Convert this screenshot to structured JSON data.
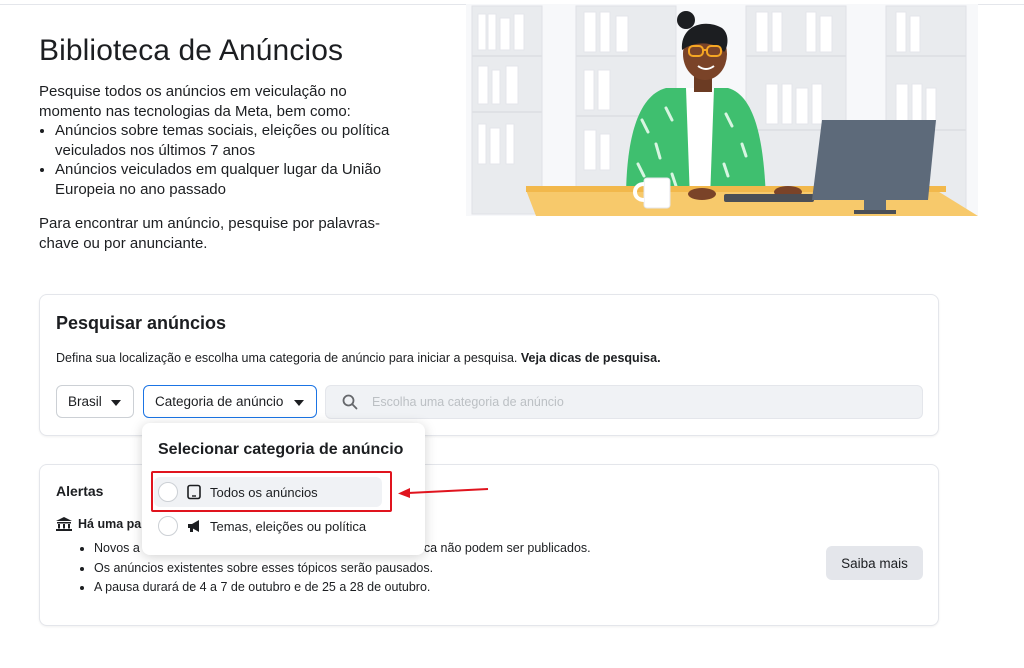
{
  "hero": {
    "title": "Biblioteca de Anúncios",
    "intro": "Pesquise todos os anúncios em veiculação no momento nas tecnologias da Meta, bem como:",
    "bullets": [
      "Anúncios sobre temas sociais, eleições ou política veiculados nos últimos 7 anos",
      "Anúncios veiculados em qualquer lugar da União Europeia no ano passado"
    ],
    "outro": "Para encontrar um anúncio, pesquise por palavras-chave ou por anunciante."
  },
  "search": {
    "title": "Pesquisar anúncios",
    "description": "Defina sua localização e escolha uma categoria de anúncio para iniciar a pesquisa.",
    "tips_link": "Veja dicas de pesquisa.",
    "country": "Brasil",
    "category": "Categoria de anúncio",
    "placeholder": "Escolha uma categoria de anúncio"
  },
  "dropdown": {
    "title": "Selecionar categoria de anúncio",
    "options": [
      {
        "label": "Todos os anúncios",
        "icon": "tablet-icon"
      },
      {
        "label": "Temas, eleições ou política",
        "icon": "megaphone-icon"
      }
    ]
  },
  "alerts": {
    "title": "Alertas",
    "headline": "Há uma pa",
    "bullets": [
      "Novos a",
      "ca não podem ser publicados.",
      "Os anúncios existentes sobre esses tópicos serão pausados.",
      "A pausa durará de 4 a 7 de outubro e de 25 a 28 de outubro."
    ],
    "more_button": "Saiba mais"
  },
  "colors": {
    "accent": "#1b74e4",
    "highlight": "#e0141e"
  }
}
